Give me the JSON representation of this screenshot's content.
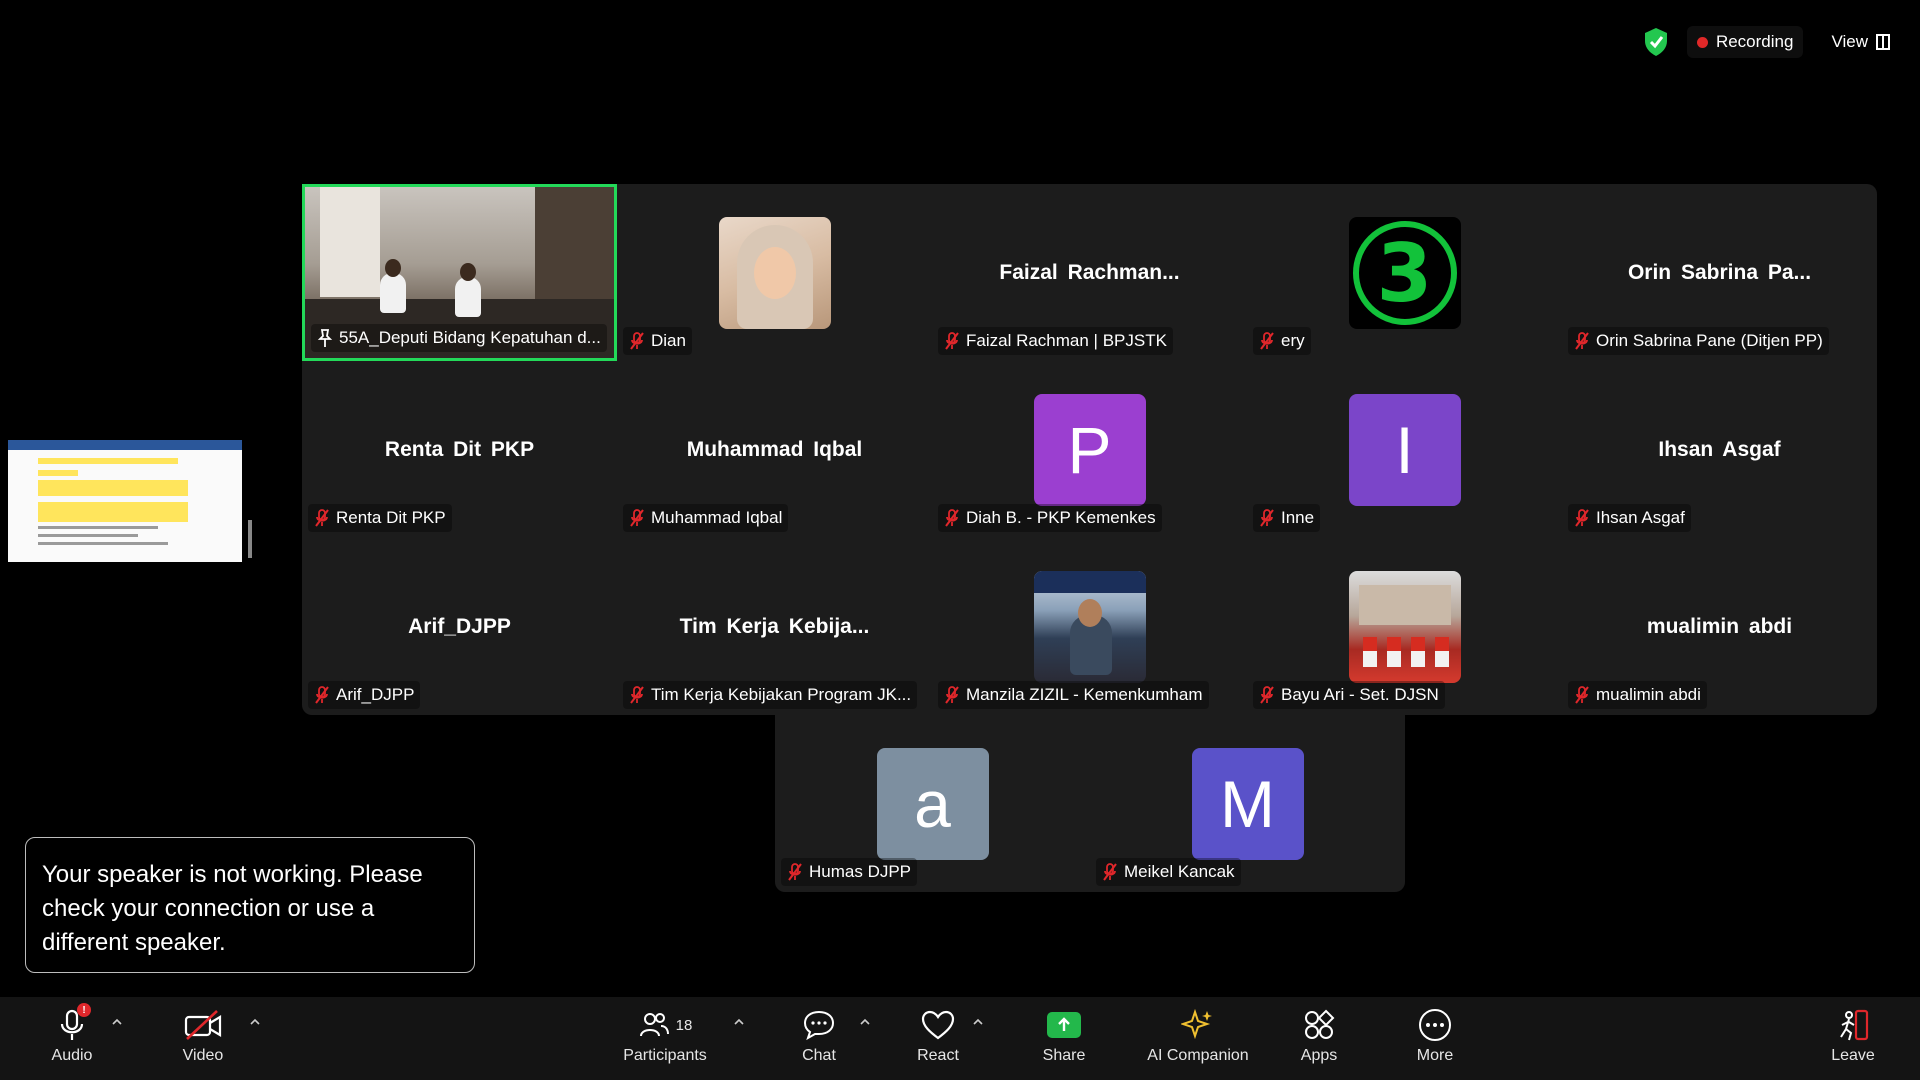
{
  "topbar": {
    "recording_label": "Recording",
    "view_label": "View"
  },
  "gallery": {
    "tiles": [
      {
        "label": "55A_Deputi Bidang Kepatuhan d...",
        "kind": "video"
      },
      {
        "label": "Dian",
        "kind": "photo"
      },
      {
        "display_name": "Faizal  Rachman...",
        "label": "Faizal Rachman | BPJSTK",
        "kind": "name"
      },
      {
        "label": "ery",
        "kind": "logo",
        "logo_text": "3"
      },
      {
        "display_name": "Orin  Sabrina  Pa...",
        "label": "Orin Sabrina Pane (Ditjen PP)",
        "kind": "name"
      },
      {
        "display_name": "Renta Dit PKP",
        "label": "Renta Dit PKP",
        "kind": "name"
      },
      {
        "display_name": "Muhammad Iqbal",
        "label": "Muhammad Iqbal",
        "kind": "name"
      },
      {
        "avatar_letter": "P",
        "avatar_color": "#9b3fd0",
        "label": "Diah B. - PKP Kemenkes",
        "kind": "avatar"
      },
      {
        "avatar_letter": "I",
        "avatar_color": "#7b45c9",
        "label": "Inne",
        "kind": "avatar"
      },
      {
        "display_name": "Ihsan Asgaf",
        "label": "Ihsan Asgaf",
        "kind": "name"
      },
      {
        "display_name": "Arif_DJPP",
        "label": "Arif_DJPP",
        "kind": "name"
      },
      {
        "display_name": "Tim  Kerja  Kebija...",
        "label": "Tim Kerja Kebijakan Program JK...",
        "kind": "name"
      },
      {
        "label": "Manzila ZIZIL - Kemenkumham",
        "kind": "photo"
      },
      {
        "label": "Bayu Ari - Set. DJSN",
        "kind": "photo"
      },
      {
        "display_name": "mualimin abdi",
        "label": "mualimin abdi",
        "kind": "name"
      },
      {
        "avatar_letter": "a",
        "avatar_color": "#7d8fa0",
        "label": "Humas DJPP",
        "kind": "avatar"
      },
      {
        "avatar_letter": "M",
        "avatar_color": "#5a52c9",
        "label": "Meikel Kancak",
        "kind": "avatar"
      }
    ]
  },
  "notice": {
    "text": "Your speaker is not working. Please check your connection or use a different speaker."
  },
  "toolbar": {
    "audio": "Audio",
    "audio_badge": "!",
    "video": "Video",
    "participants": "Participants",
    "participants_count": "18",
    "chat": "Chat",
    "react": "React",
    "share": "Share",
    "ai_companion": "AI Companion",
    "apps": "Apps",
    "more": "More",
    "leave": "Leave"
  },
  "colors": {
    "active_speaker": "#23d959",
    "share_green": "#23b84b",
    "mute_red": "#e0272b",
    "recording_red": "#e02828"
  }
}
